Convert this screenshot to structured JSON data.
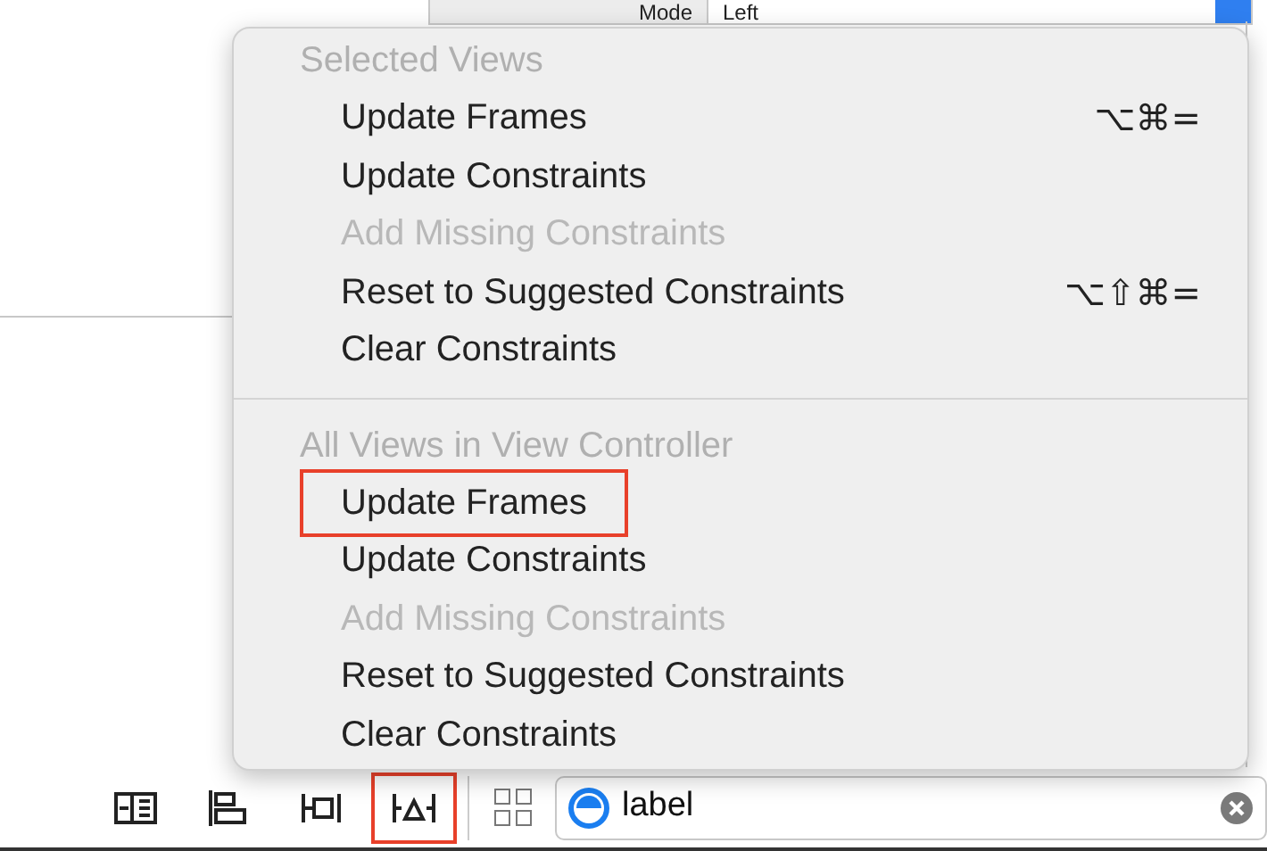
{
  "inspector": {
    "mode_label": "Mode",
    "mode_value": "Left"
  },
  "menu": {
    "sections": [
      {
        "header": "Selected Views",
        "items": [
          {
            "label": "Update Frames",
            "shortcut": "⌥⌘=",
            "disabled": false,
            "highlighted": false
          },
          {
            "label": "Update Constraints",
            "disabled": false,
            "highlighted": false
          },
          {
            "label": "Add Missing Constraints",
            "disabled": true,
            "highlighted": false
          },
          {
            "label": "Reset to Suggested Constraints",
            "shortcut": "⌥⇧⌘=",
            "disabled": false,
            "highlighted": false
          },
          {
            "label": "Clear Constraints",
            "disabled": false,
            "highlighted": false
          }
        ]
      },
      {
        "header": "All Views in View Controller",
        "items": [
          {
            "label": "Update Frames",
            "disabled": false,
            "highlighted": true
          },
          {
            "label": "Update Constraints",
            "disabled": false,
            "highlighted": false
          },
          {
            "label": "Add Missing Constraints",
            "disabled": true,
            "highlighted": false
          },
          {
            "label": "Reset to Suggested Constraints",
            "disabled": false,
            "highlighted": false
          },
          {
            "label": "Clear Constraints",
            "disabled": false,
            "highlighted": false
          }
        ]
      }
    ]
  },
  "toolbar": {
    "buttons": [
      {
        "kind": "stack",
        "highlighted": false
      },
      {
        "kind": "align",
        "highlighted": false
      },
      {
        "kind": "pin",
        "highlighted": false
      },
      {
        "kind": "resolve",
        "highlighted": true
      }
    ],
    "search": {
      "value": "label"
    }
  }
}
